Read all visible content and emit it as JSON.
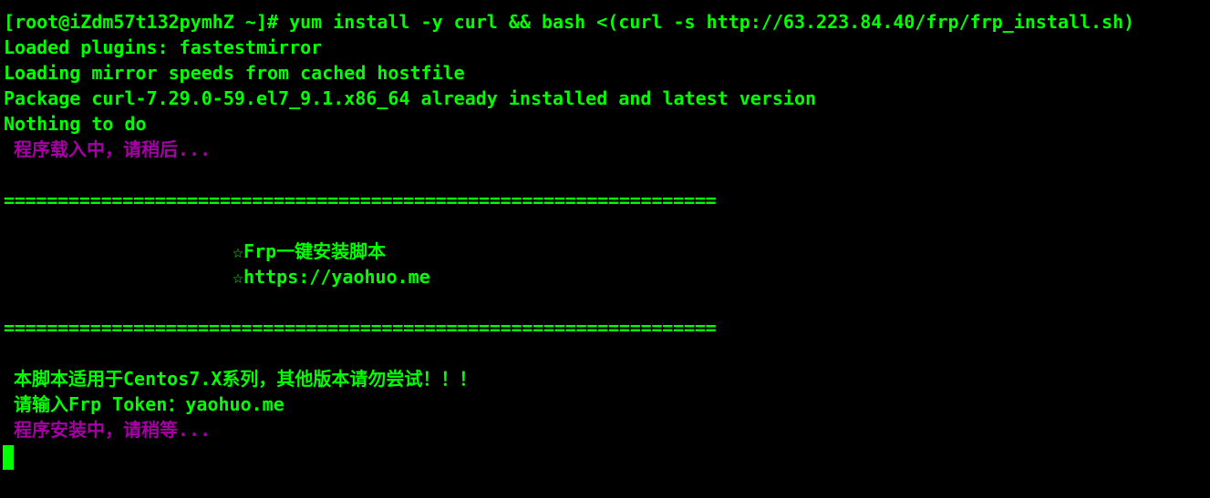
{
  "terminal": {
    "prompt_line": "[root@iZdm57t132pymhZ ~]# yum install -y curl && bash <(curl -s http://63.223.84.40/frp/frp_install.sh)",
    "loaded_plugins": "Loaded plugins: fastestmirror",
    "loading_mirror": "Loading mirror speeds from cached hostfile",
    "package_status": "Package curl-7.29.0-59.el7_9.1.x86_64 already installed and latest version",
    "nothing_to_do": "Nothing to do",
    "loading_program": "程序载入中，请稍后...",
    "separator_top": "==================================================================",
    "banner_title": "☆Frp一键安装脚本",
    "banner_url": "☆https://yaohuo.me",
    "separator_bottom": "==================================================================",
    "compat_notice": "本脚本适用于Centos7.X系列，其他版本请勿尝试！！！",
    "token_prompt": "请输入Frp Token：yaohuo.me",
    "installing": "程序安装中，请稍等..."
  },
  "colors": {
    "background": "#000000",
    "text_green": "#00ff00",
    "text_purple": "#a500a5",
    "cursor": "#00ff00"
  }
}
